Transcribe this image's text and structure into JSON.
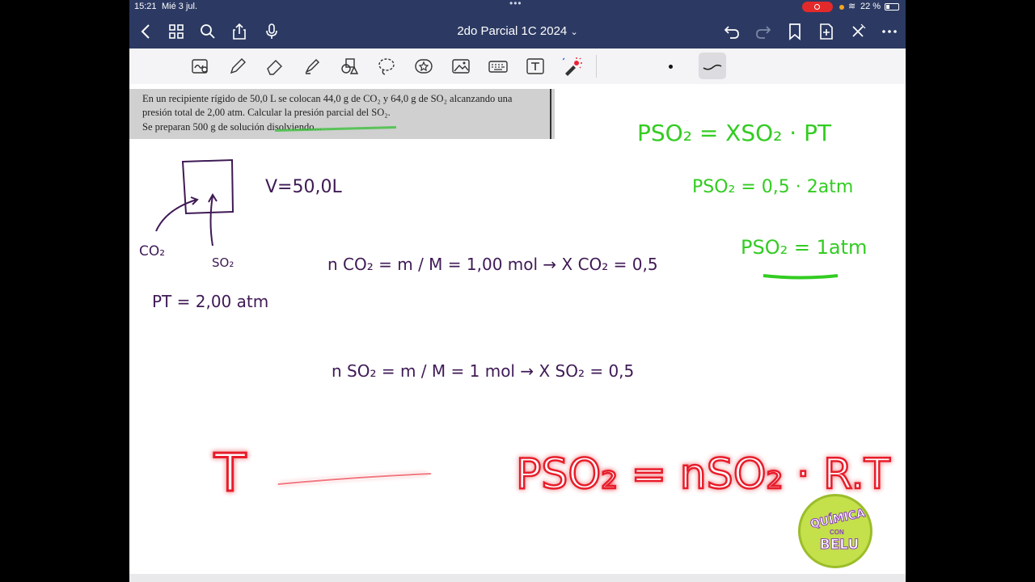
{
  "status_bar": {
    "time": "15:21",
    "date": "Mié 3 jul.",
    "battery": "22 %"
  },
  "nav": {
    "document_title": "2do Parcial 1C 2024",
    "title_chevron": "⌄"
  },
  "toolbar": {
    "tools": [
      "lasso-magnify-icon",
      "pen-icon",
      "eraser-icon",
      "highlighter-icon",
      "shapes-icon",
      "lasso-icon",
      "sticker-icon",
      "image-icon",
      "keyboard-icon",
      "text-box-icon",
      "laser-pointer-icon"
    ]
  },
  "scan": {
    "line1": "En un recipiente rígido de 50,0 L se colocan 44,0 g de CO₂ y 64,0 g de SO₂ alcanzando una",
    "line2": "presión total de 2,00 atm. Calcular la presión parcial del SO₂.",
    "line3": "Se preparan 500 g de solución disolviendo..."
  },
  "notes": {
    "volume": "V=50,0L",
    "label_co2": "CO₂",
    "label_so2": "SO₂",
    "total_pressure": "PT = 2,00 atm",
    "n_co2": "n CO₂ = m / M = 1,00 mol → X CO₂ = 0,5",
    "n_so2": "n SO₂ = m / M = 1 mol → X SO₂ = 0,5",
    "green_eq1": "PSO₂ = XSO₂ · PT",
    "green_eq2": "PSO₂ = 0,5 · 2atm",
    "green_eq3": "PSO₂ = 1atm",
    "red_left": "T",
    "red_right": "PSO₂ = nSO₂ · R.T"
  },
  "logo": {
    "line1": "QUÍMICA",
    "line2": "CON",
    "line3": "BELU"
  },
  "colors": {
    "nav_bg": "#2c3a63",
    "ink_purple": "#3f1a55",
    "ink_green": "#33cc22",
    "ink_red": "#e81b2a"
  }
}
